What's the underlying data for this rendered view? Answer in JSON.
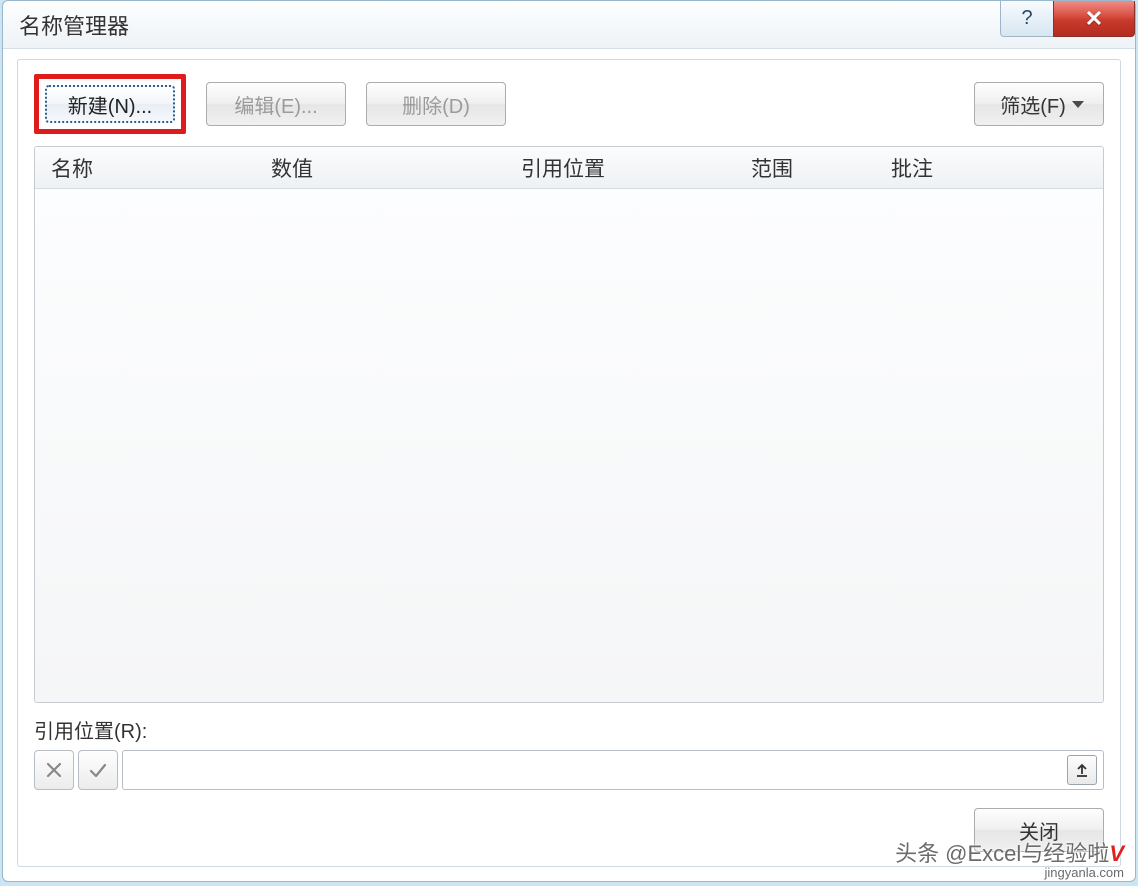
{
  "title": "名称管理器",
  "titlebar": {
    "help_symbol": "?",
    "close_symbol": "✕"
  },
  "toolbar": {
    "new_label": "新建(N)...",
    "edit_label": "编辑(E)...",
    "delete_label": "删除(D)",
    "filter_label": "筛选(F)"
  },
  "columns": {
    "name": "名称",
    "value": "数值",
    "ref": "引用位置",
    "scope": "范围",
    "comment": "批注"
  },
  "ref_section": {
    "label": "引用位置(R):",
    "input_value": ""
  },
  "footer": {
    "close_label": "关闭"
  },
  "watermark": {
    "text": "头条 @Excel与经验啦",
    "badge": "V",
    "site": "jingyanla.com"
  }
}
